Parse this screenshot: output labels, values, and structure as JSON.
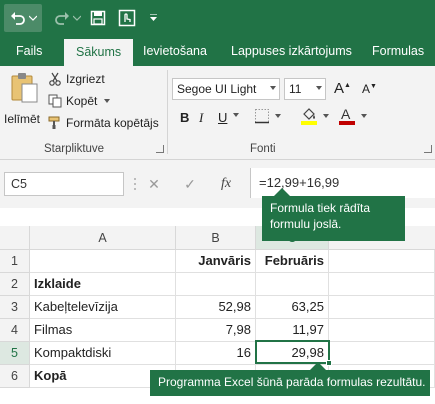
{
  "qat": {
    "undo_icon": "undo-icon",
    "redo_icon": "redo-icon",
    "save_icon": "save-icon",
    "touch_icon": "touch-mode-icon",
    "more_icon": "chevron-down-icon"
  },
  "tabs": [
    "Fails",
    "Sākums",
    "Ievietošana",
    "Lappuses izkārtojums",
    "Formulas"
  ],
  "active_tab": "Sākums",
  "ribbon": {
    "clipboard": {
      "paste_label": "Ielīmēt",
      "cut_label": "Izgriezt",
      "copy_label": "Kopēt",
      "format_painter_label": "Formāta kopētājs",
      "group_label": "Starpliktuve"
    },
    "font": {
      "font_name": "Segoe UI Light",
      "font_size": "11",
      "bold": "B",
      "italic": "I",
      "underline": "U",
      "group_label": "Fonti",
      "fill_color": "#ffff00",
      "font_color": "#c00000"
    }
  },
  "formula_bar": {
    "name_box": "C5",
    "cancel": "✕",
    "enter": "✓",
    "fx": "fx",
    "formula": "=12,99+16,99"
  },
  "callouts": {
    "formula_bar_note": "Formula tiek rādīta formulu joslā.",
    "result_note": "Programma Excel šūnā parāda formulas rezultātu."
  },
  "sheet": {
    "columns": [
      "A",
      "B",
      "C"
    ],
    "rows": [
      {
        "n": "1",
        "a": "",
        "b": "Janvāris",
        "c": "Februāris"
      },
      {
        "n": "2",
        "a": "Izklaide",
        "b": "",
        "c": ""
      },
      {
        "n": "3",
        "a": "Kabeļtelevīzija",
        "b": "52,98",
        "c": "63,25"
      },
      {
        "n": "4",
        "a": "Filmas",
        "b": "7,98",
        "c": "11,97"
      },
      {
        "n": "5",
        "a": "Kompaktdiski",
        "b": "16",
        "c": "29,98"
      },
      {
        "n": "6",
        "a": "Kopā",
        "b": "",
        "c": ""
      }
    ],
    "selected_cell": "C5"
  },
  "colors": {
    "accent": "#217346"
  }
}
